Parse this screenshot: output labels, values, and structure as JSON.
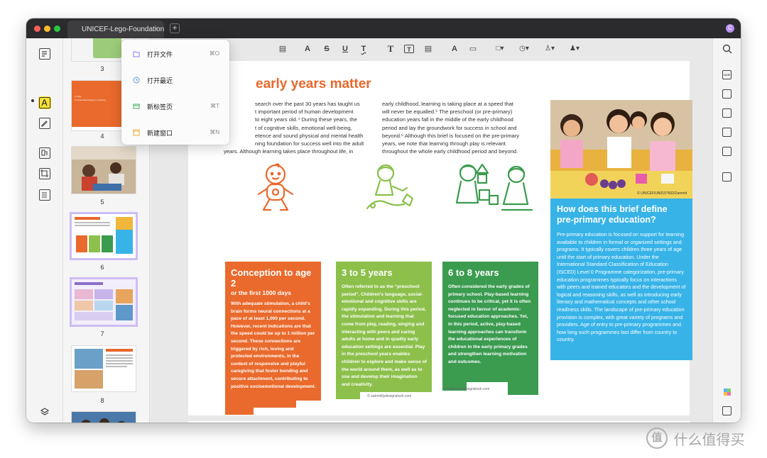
{
  "window": {
    "tab_title": "UNICEF-Lego-Foundation",
    "tab_close": "×",
    "tab_add": "+",
    "user_initial": "C",
    "traffic_colors": [
      "#fe5f57",
      "#febc2e",
      "#28c840"
    ]
  },
  "left_sidebar": {
    "icons": [
      "reader-icon",
      "highlight-icon",
      "edit-icon",
      "organize-icon",
      "crop-icon",
      "form-icon",
      "layers-icon",
      "bookmark-icon"
    ],
    "active": "highlight-icon",
    "active_color": "#f8e233"
  },
  "thumbnails": {
    "page_numbers": [
      "3",
      "4",
      "5",
      "6",
      "7",
      "8"
    ],
    "selected": [
      "6",
      "7"
    ],
    "selection_color": "#cdbdf5",
    "thumb4": {
      "title_line1": "3. Play",
      "title_line2": "An essential strategy for learning"
    }
  },
  "file_menu": {
    "items": [
      {
        "label": "打开文件",
        "shortcut": "⌘O",
        "icon": "folder-icon",
        "icon_color": "#8e7bef"
      },
      {
        "label": "打开最近",
        "shortcut": "",
        "icon": "clock-icon",
        "icon_color": "#5b9bdb"
      },
      {
        "label": "新标签页",
        "shortcut": "⌘T",
        "icon": "new-tab-icon",
        "icon_color": "#3fae5a"
      },
      {
        "label": "新建窗口",
        "shortcut": "⌘N",
        "icon": "new-window-icon",
        "icon_color": "#e8a93a"
      }
    ]
  },
  "toolbar": {
    "tools": [
      {
        "name": "comment-tool",
        "glyph": "▤"
      },
      {
        "name": "highlight-tool",
        "glyph": "A"
      },
      {
        "name": "strikethrough-tool",
        "glyph": "S"
      },
      {
        "name": "underline-tool",
        "glyph": "U"
      },
      {
        "name": "squiggly-tool",
        "glyph": "T"
      },
      {
        "name": "text-tool",
        "glyph": "T"
      },
      {
        "name": "textbox-tool",
        "glyph": "T"
      },
      {
        "name": "callout-tool",
        "glyph": "▤"
      },
      {
        "name": "pencil-tool",
        "glyph": "A"
      },
      {
        "name": "eraser-tool",
        "glyph": "▭"
      },
      {
        "name": "shape-tool",
        "glyph": "□▾"
      },
      {
        "name": "pen-tool",
        "glyph": "◷▾"
      },
      {
        "name": "signature-tool",
        "glyph": "♙▾"
      },
      {
        "name": "stamp-tool",
        "glyph": "♟▾"
      }
    ]
  },
  "right_sidebar": {
    "icons": [
      "search-icon",
      "ocr-icon",
      "convert-icon",
      "protect-icon",
      "share-icon",
      "mail-icon",
      "save-icon",
      "ai-icon",
      "comment-list-icon"
    ],
    "ocr_label": "OCR"
  },
  "document": {
    "heading": "early years matter",
    "col1": [
      "search over the past 30 years has taught us",
      "t important period of human development",
      "to eight years old.⁴ During these years, the",
      "t of cognitive skills, emotional well-being,",
      "etence and sound physical and mental health",
      "ning foundation for success well into the adult",
      "years. Although learning takes place throughout life, in"
    ],
    "col2": [
      "early childhood, learning is taking place at a speed that",
      "will never be equalled.⁵ The preschool (or pre-primary)",
      "education years fall in the middle of the early childhood",
      "period and lay the groundwork for success in school and",
      "beyond.⁶ Although this brief is focused on the pre-primary",
      "years, we note that learning through play is relevant",
      "throughout the whole early childhood period and beyond."
    ],
    "photo_credit": "© UNICEF/UN0157602/Zammit",
    "card_colors": [
      "#e96a2c",
      "#8cc04b",
      "#3b9b4f"
    ],
    "cards": [
      {
        "title": "Conception to age 2",
        "subtitle": "or the first 1000 days",
        "body": "With adequate stimulation, a child's brain forms neural connections at a pace of at least 1,000 per second. However, recent indications are that the speed could be up to 1 million per second. These connections are triggered by rich, loving and protected environments, in the context of responsive and playful caregiving that foster bonding and secure attachment, contributing to positive socioemotional development."
      },
      {
        "title": "3 to 5 years",
        "subtitle": "",
        "body": "Often referred to as the “preschool period”. Children's language, social-emotional and cognitive skills are rapidly expanding. During this period, the stimulation and learning that come from play, reading, singing and interacting with peers and caring adults at home and in quality early education settings are essential. Play in the preschool years enables children to explore and make sense of the world around them, as well as to use and develop their imagination and creativity."
      },
      {
        "title": "6 to 8 years",
        "subtitle": "",
        "body": "Often considered the early grades of primary school. Play-based learning continues to be critical, yet it is often neglected in favour of academic-focused education approaches. Yet, in this period, active, play-based learning approaches can transform the educational experiences of children in the early primary grades and strengthen learning motivation and outcomes."
      }
    ],
    "card_credits": [
      "© swimhillydesignstock.com",
      "© swimhillydesignstock.com"
    ],
    "blue_box_color": "#37b3e8",
    "blue_box": {
      "title": "How does this brief define pre-primary education?",
      "body": "Pre-primary education is focused on support for learning available to children in formal or organized settings and programs. It typically covers children three years of age until the start of primary education. Under the International Standard Classification of Education (ISCED) Level 0 Programme categorization, pre-primary education programmes typically focus on interactions with peers and trained educators and the development of logical and reasoning skills, as well as introducing early literacy and mathematical concepts and other school readiness skills. The landscape of pre-primary education provision is complex, with great variety of programs and providers. Age of entry to pre-primary programmes and how long such programmes last differ from country to country."
    }
  },
  "watermark": {
    "text": "什么值得买",
    "badge": "值"
  }
}
